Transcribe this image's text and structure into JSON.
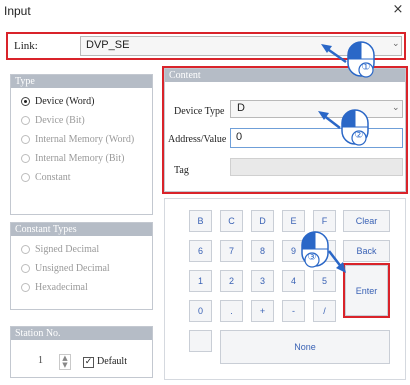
{
  "window": {
    "title": "Input",
    "close_glyph": "×"
  },
  "link": {
    "label": "Link:",
    "value": "DVP_SE",
    "arrow_glyph": "⌄"
  },
  "type_group": {
    "header": "Type",
    "options": [
      {
        "label": "Device (Word)",
        "selected": true
      },
      {
        "label": "Device (Bit)",
        "selected": false
      },
      {
        "label": "Internal Memory (Word)",
        "selected": false
      },
      {
        "label": "Internal Memory (Bit)",
        "selected": false
      },
      {
        "label": "Constant",
        "selected": false
      }
    ]
  },
  "constant_types": {
    "header": "Constant Types",
    "options": [
      {
        "label": "Signed Decimal"
      },
      {
        "label": "Unsigned Decimal"
      },
      {
        "label": "Hexadecimal"
      }
    ]
  },
  "station": {
    "header": "Station No.",
    "value": "1",
    "default_label": "Default",
    "default_checked": true,
    "check_glyph": "✓",
    "up_glyph": "▲",
    "down_glyph": "▼"
  },
  "content": {
    "header": "Content",
    "device_type_label": "Device Type",
    "device_type_value": "D",
    "device_type_arrow": "⌄",
    "address_label": "Address/Value",
    "address_value": "0",
    "tag_label": "Tag"
  },
  "keypad": {
    "row1": [
      "B",
      "C",
      "D",
      "E",
      "F",
      "Clear"
    ],
    "row2": [
      "6",
      "7",
      "8",
      "9",
      "A",
      "Back"
    ],
    "row3": [
      "1",
      "2",
      "3",
      "4",
      "5"
    ],
    "row4": [
      "0",
      ".",
      "+",
      "-",
      "/"
    ],
    "enter": "Enter",
    "none": "None"
  },
  "callouts": [
    "①",
    "②",
    "③"
  ],
  "colors": {
    "highlight_red": "#d9232a",
    "callout_blue": "#2a67c7",
    "group_header": "#b5bcc6",
    "key_text": "#3b63b5"
  }
}
